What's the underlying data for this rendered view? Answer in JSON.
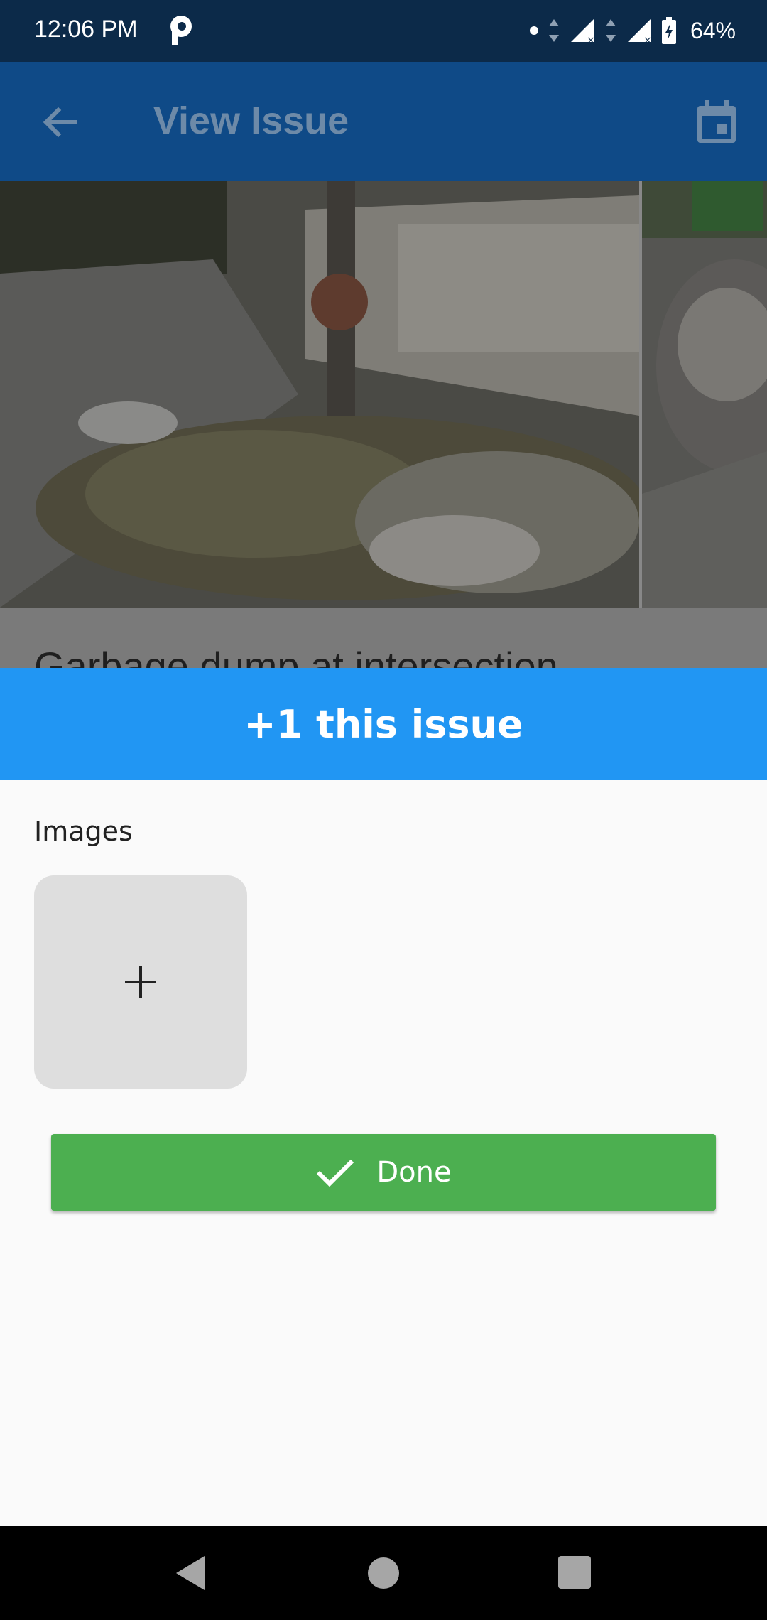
{
  "status_bar": {
    "time": "12:06 PM",
    "battery_percent": "64%",
    "icons": [
      "parking-app-icon",
      "dot-icon",
      "data-arrows-icon",
      "signal-icon",
      "signal-icon",
      "battery-charging-icon"
    ]
  },
  "app_bar": {
    "title": "View Issue",
    "back_icon": "arrow-left-icon",
    "action_icon": "calendar-icon"
  },
  "issue": {
    "title": "Garbage dump at intersection"
  },
  "sheet": {
    "title": "+1 this issue",
    "images_label": "Images",
    "add_image_icon": "plus-icon",
    "done_label": "Done"
  },
  "colors": {
    "status_bar": "#0c2a49",
    "app_bar": "#0f4a87",
    "sheet_header": "#2196f3",
    "done_button": "#4caf50",
    "sheet_bg": "#fafafa"
  },
  "nav_bar": {
    "icons": [
      "back-triangle-icon",
      "home-circle-icon",
      "recents-square-icon"
    ]
  }
}
